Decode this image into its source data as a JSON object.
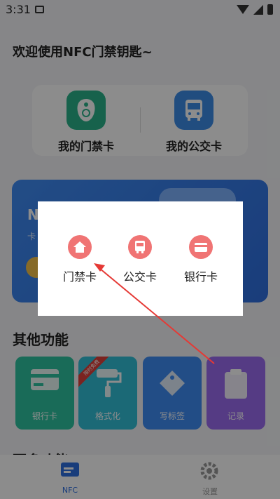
{
  "status": {
    "time": "3:31"
  },
  "greeting": "欢迎使用NFC门禁钥匙~",
  "top_cards": [
    {
      "label": "我的门禁卡",
      "icon": "keyfob-icon",
      "color": "#2bb28a"
    },
    {
      "label": "我的公交卡",
      "icon": "bus-icon",
      "color": "#3c8de8"
    }
  ],
  "banner": {
    "title": "N",
    "subtitle": "卡"
  },
  "other_section": {
    "title": "其他功能",
    "tiles": [
      {
        "label": "银行卡",
        "icon": "bank-card-icon",
        "color": "#2fc4a0"
      },
      {
        "label": "格式化",
        "icon": "roller-brush-icon",
        "color": "#32c0d8",
        "badge": "限时免费"
      },
      {
        "label": "写标签",
        "icon": "tag-icon",
        "color": "#3f8cf4"
      },
      {
        "label": "记录",
        "icon": "clipboard-icon",
        "color": "#9b6cf0"
      }
    ]
  },
  "more_section": {
    "title": "更多功能"
  },
  "bottom_nav": [
    {
      "label": "NFC",
      "icon": "card-icon",
      "active": true
    },
    {
      "label": "设置",
      "icon": "gear-icon",
      "active": false
    }
  ],
  "dialog": {
    "options": [
      {
        "label": "门禁卡",
        "icon": "home-icon"
      },
      {
        "label": "公交卡",
        "icon": "bus-icon"
      },
      {
        "label": "银行卡",
        "icon": "bank-card-icon"
      }
    ]
  },
  "colors": {
    "accent_red": "#f07474",
    "annotation_arrow": "#e53935"
  }
}
